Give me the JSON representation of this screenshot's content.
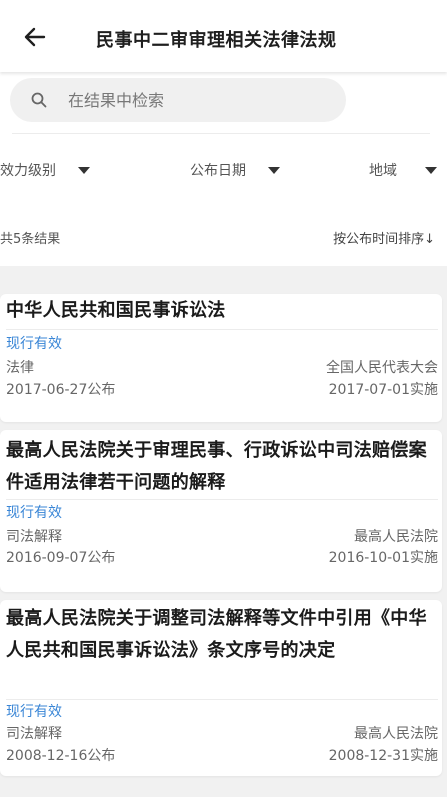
{
  "header": {
    "title": "民事中二审审理相关法律法规",
    "back_icon": "back-arrow-icon"
  },
  "search": {
    "placeholder": "在结果中检索",
    "value": ""
  },
  "filters": [
    {
      "label": "效力级别"
    },
    {
      "label": "公布日期"
    },
    {
      "label": "地域"
    }
  ],
  "results": {
    "count_text": "共5条结果",
    "sort_label": "按公布时间排序↓"
  },
  "colors": {
    "status": "#3a86d6",
    "background": "#f1f1f1"
  },
  "items": [
    {
      "title": "中华人民共和国民事诉讼法",
      "status": "现行有效",
      "type": "法律",
      "issuer": "全国人民代表大会",
      "published": "2017-06-27公布",
      "effective": "2017-07-01实施"
    },
    {
      "title": "最高人民法院关于审理民事、行政诉讼中司法赔偿案件适用法律若干问题的解释",
      "status": "现行有效",
      "type": "司法解释",
      "issuer": "最高人民法院",
      "published": "2016-09-07公布",
      "effective": "2016-10-01实施"
    },
    {
      "title": "最高人民法院关于调整司法解释等文件中引用《中华人民共和国民事诉讼法》条文序号的决定",
      "status": "现行有效",
      "type": "司法解释",
      "issuer": "最高人民法院",
      "published": "2008-12-16公布",
      "effective": "2008-12-31实施"
    }
  ]
}
